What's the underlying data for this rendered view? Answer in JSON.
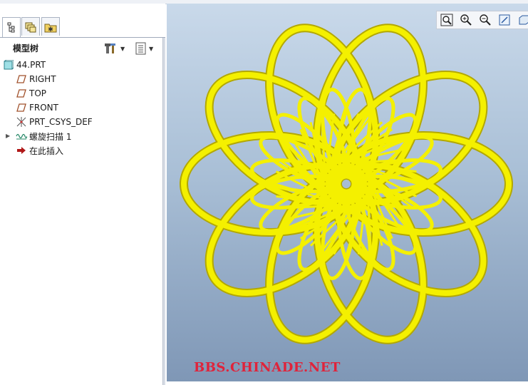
{
  "panel": {
    "title": "模型树"
  },
  "tree": {
    "items": [
      {
        "label": "44.PRT",
        "icon": "part-icon"
      },
      {
        "label": "RIGHT",
        "icon": "datum-plane-icon"
      },
      {
        "label": "TOP",
        "icon": "datum-plane-icon"
      },
      {
        "label": "FRONT",
        "icon": "datum-plane-icon"
      },
      {
        "label": "PRT_CSYS_DEF",
        "icon": "coordinate-system-icon"
      },
      {
        "label": "螺旋扫描 1",
        "icon": "helical-sweep-icon"
      },
      {
        "label": "在此插入",
        "icon": "insert-here-arrow-icon"
      }
    ]
  },
  "viewport": {
    "watermark": "BBS.CHINADE.NET",
    "model_color": "#f4f000",
    "toolbar": [
      "refit-icon",
      "zoom-in-icon",
      "zoom-out-icon",
      "repaint-icon",
      "view-orient-icon"
    ]
  }
}
